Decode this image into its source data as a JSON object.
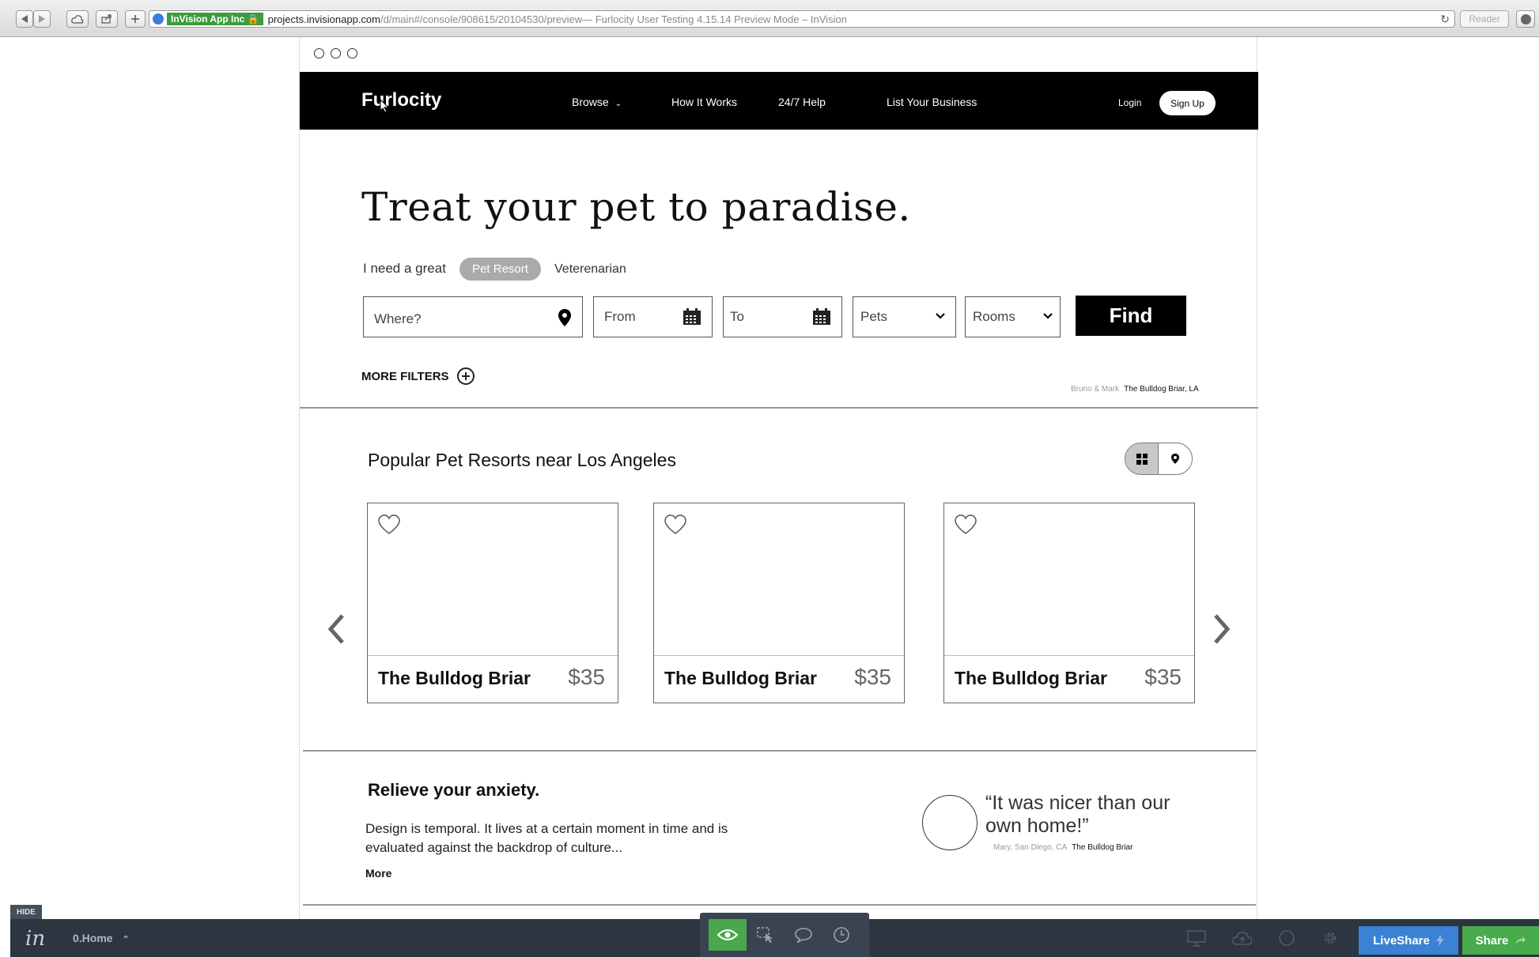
{
  "browser": {
    "cert_label": "InVision App Inc",
    "url_host": "projects.invisionapp.com",
    "url_path": "/d/main#/console/908615/20104530/preview",
    "page_title": " — Furlocity User Testing 4.15.14 Preview Mode – InVision",
    "reader_label": "Reader"
  },
  "nav": {
    "logo": "Furlocity",
    "browse": "Browse",
    "how_it_works": "How It Works",
    "help": "24/7 Help",
    "list_business": "List Your Business",
    "login": "Login",
    "signup": "Sign Up"
  },
  "hero": {
    "headline": "Treat your pet to paradise.",
    "need_label": "I need a great",
    "option_selected": "Pet Resort",
    "option_other": "Veterenarian"
  },
  "search": {
    "where_placeholder": "Where?",
    "from_placeholder": "From",
    "to_placeholder": "To",
    "pets_label": "Pets",
    "rooms_label": "Rooms",
    "find_label": "Find",
    "more_filters": "MORE FILTERS"
  },
  "photo_credit": {
    "names": "Bruno & Mark",
    "place": "The Bulldog Briar, LA"
  },
  "popular": {
    "title": "Popular Pet Resorts near Los Angeles",
    "cards": [
      {
        "name": "The Bulldog Briar",
        "price": "$35"
      },
      {
        "name": "The Bulldog Briar",
        "price": "$35"
      },
      {
        "name": "The Bulldog Briar",
        "price": "$35"
      }
    ]
  },
  "anxiety": {
    "title": "Relieve your anxiety.",
    "body": "Design is temporal. It lives at a certain moment in time and is evaluated against the backdrop of culture...",
    "more": "More",
    "quote": "“It was nicer than our own home!”",
    "quote_author": "Mary, San Diego, CA",
    "quote_place": "The Bulldog Briar"
  },
  "invision": {
    "hide_label": "HIDE",
    "logo": "in",
    "screen_name": "0.Home",
    "liveshare": "LiveShare",
    "share": "Share"
  },
  "colors": {
    "nav_bg": "#000000",
    "liveshare": "#3b82d4",
    "share": "#48ab4c",
    "preview_active": "#49a84b",
    "toolbar_bg": "#2d3540"
  }
}
